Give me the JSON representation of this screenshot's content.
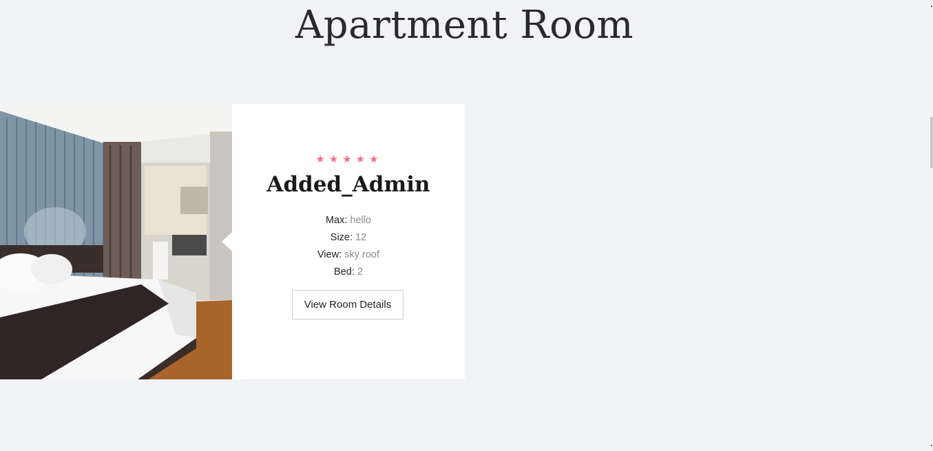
{
  "page": {
    "title": "Apartment Room"
  },
  "room": {
    "image_alt": "Hotel bedroom with bed and bathroom",
    "rating": 5,
    "star_icon": "star-icon",
    "star_color": "#f0708a",
    "name": "Added_Admin",
    "specs": [
      {
        "label": "Max:",
        "value": "hello"
      },
      {
        "label": "Size:",
        "value": "12"
      },
      {
        "label": "View:",
        "value": "sky roof"
      },
      {
        "label": "Bed:",
        "value": "2"
      }
    ],
    "details_button": "View Room Details"
  }
}
